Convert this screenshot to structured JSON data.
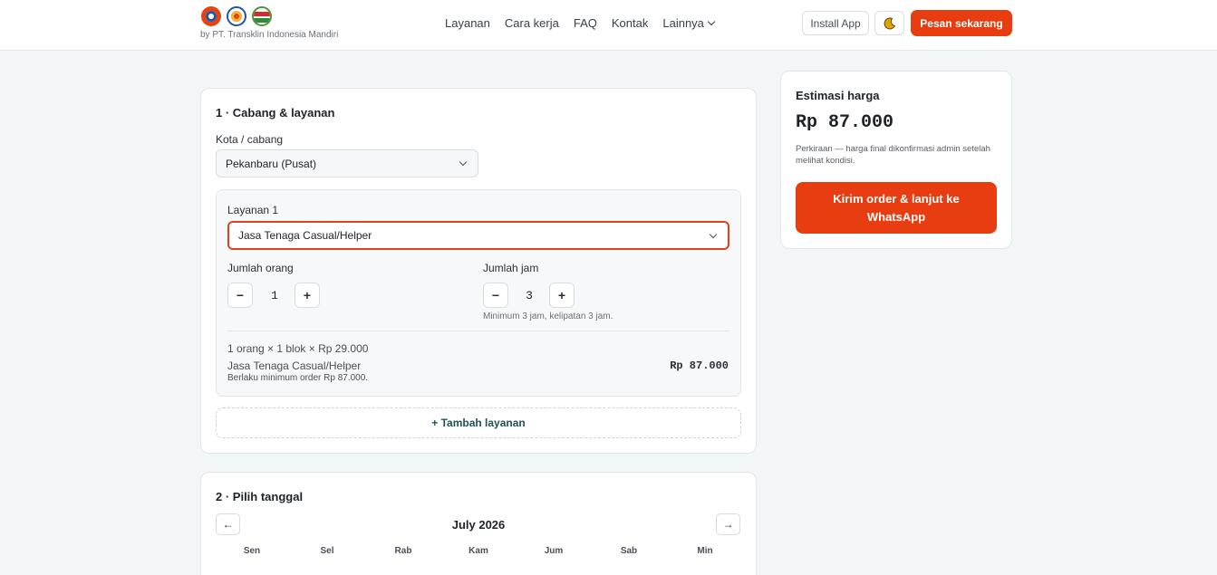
{
  "header": {
    "byline": "by PT. Transklin Indonesia Mandiri",
    "nav": [
      "Layanan",
      "Cara kerja",
      "FAQ",
      "Kontak",
      "Lainnya"
    ],
    "install_label": "Install App",
    "theme_icon": "moon-icon",
    "order_label": "Pesan sekarang",
    "colors": {
      "accent": "#e83d10",
      "link": "#20535a"
    }
  },
  "section1": {
    "title": "1 · Cabang & layanan",
    "city_label": "Kota / cabang",
    "city_value": "Pekanbaru (Pusat)",
    "service": {
      "label": "Layanan 1",
      "value": "Jasa Tenaga Casual/Helper",
      "people_label": "Jumlah orang",
      "people_value": "1",
      "hours_label": "Jumlah jam",
      "hours_value": "3",
      "hours_hint": "Minimum 3 jam, kelipatan 3 jam.",
      "minus": "−",
      "plus": "+",
      "calc_line": "1 orang × 1 blok × Rp 29.000",
      "item_name": "Jasa Tenaga Casual/Helper",
      "item_price": "Rp 87.000",
      "min_note": "Berlaku minimum order Rp 87.000."
    },
    "add_label": "+ Tambah layanan"
  },
  "section2": {
    "title": "2 · Pilih tanggal",
    "month": "July 2026",
    "prev": "←",
    "next": "→",
    "weekdays": [
      "Sen",
      "Sel",
      "Rab",
      "Kam",
      "Jum",
      "Sab",
      "Min"
    ]
  },
  "sidebar": {
    "title": "Estimasi harga",
    "price": "Rp 87.000",
    "note": "Perkiraan — harga final dikonfirmasi admin setelah melihat kondisi.",
    "cta": "Kirim order & lanjut ke WhatsApp"
  }
}
